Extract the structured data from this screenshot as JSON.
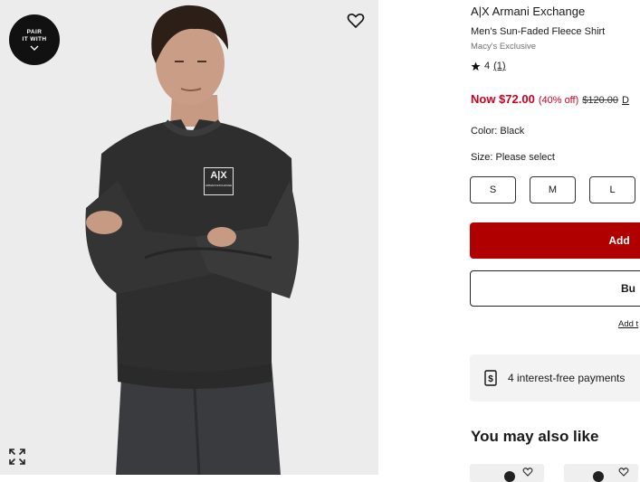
{
  "image_panel": {
    "pair_badge": {
      "line1": "PAIR",
      "line2": "IT WITH"
    },
    "shirt_logo": {
      "mark": "A|X",
      "sub": "ARMANI EXCHANGE"
    }
  },
  "product": {
    "brand": "A|X Armani Exchange",
    "name": "Men's Sun-Faded Fleece Shirt",
    "exclusive": "Macy's Exclusive",
    "rating": {
      "stars": "4",
      "count": "(1)"
    },
    "price": {
      "now": "Now $72.00",
      "discount": "(40% off)",
      "was": "$120.00",
      "extra": "D"
    },
    "color": "Color: Black",
    "size_label": "Size: Please select",
    "sizes": [
      "S",
      "M",
      "L"
    ]
  },
  "actions": {
    "add_label": "Add",
    "buy_label": "Bu",
    "add_to_link": "Add t"
  },
  "payments": {
    "text": "4 interest-free payments"
  },
  "recommendations": {
    "title": "You may also like"
  },
  "colors": {
    "accent_red": "#d1001f",
    "button_red": "#b00000",
    "sweater": "#2e2e2f"
  }
}
